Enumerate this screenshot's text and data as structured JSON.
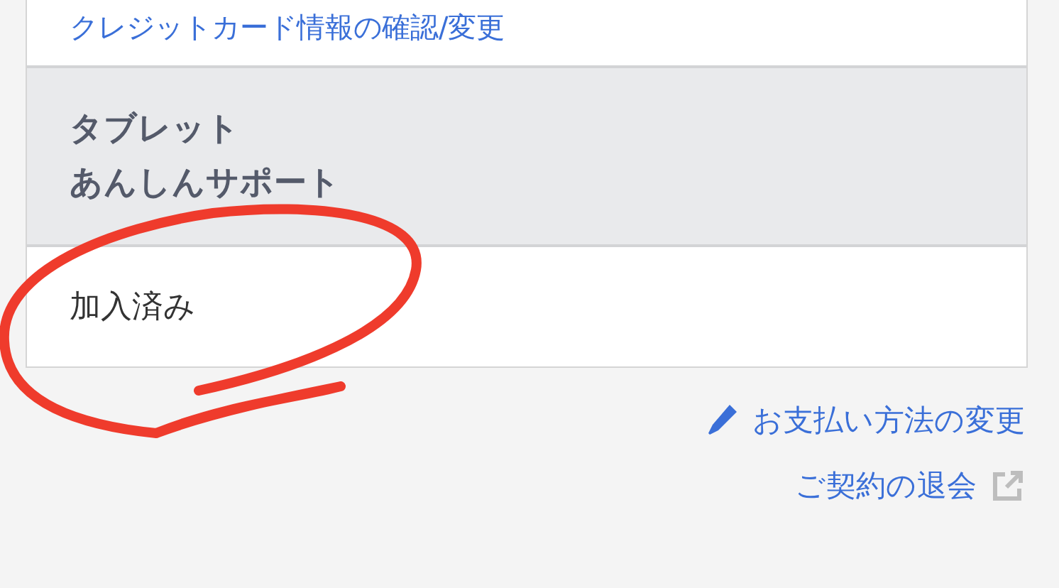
{
  "top_link": "クレジットカード情報の確認/変更",
  "section": {
    "heading_lines": [
      "タブレット",
      "あんしんサポート"
    ],
    "value": "加入済み"
  },
  "links": [
    {
      "kind": "edit",
      "label": "お支払い方法の変更"
    },
    {
      "kind": "external",
      "label": "ご契約の退会"
    }
  ]
}
